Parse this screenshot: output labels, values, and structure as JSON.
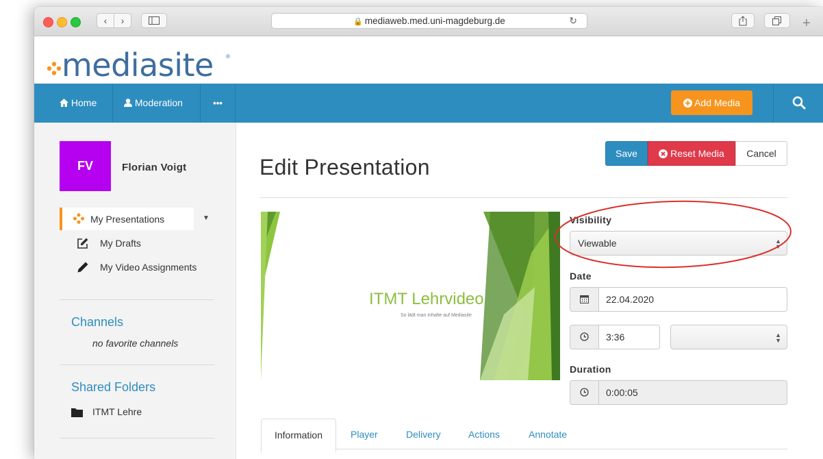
{
  "browser": {
    "url": "mediaweb.med.uni-magdeburg.de",
    "icons": [
      "back-icon",
      "forward-icon",
      "sidebar-icon",
      "lock-icon",
      "reload-icon",
      "share-icon",
      "tabs-icon",
      "new-tab-icon"
    ]
  },
  "brand": {
    "logo_text": "mediasite",
    "reg": "®",
    "colors": {
      "dots": [
        "#f7941d",
        "#c22f8b",
        "#8cc63f",
        "#2e8dbf"
      ],
      "text": "#3e6e9e"
    }
  },
  "nav": {
    "home_label": "Home",
    "moderation_label": "Moderation",
    "more_label": "•••",
    "add_media_label": "Add Media",
    "colors": {
      "bar": "#2e8dbf",
      "add_media": "#f7941d"
    }
  },
  "user": {
    "initials": "FV",
    "name": "Florian Voigt",
    "avatar_color": "#b600f0"
  },
  "sidebar": {
    "my_presentations": "My Presentations",
    "my_drafts": "My Drafts",
    "my_video_assignments": "My Video Assignments",
    "channels_heading": "Channels",
    "channels_note": "no favorite channels",
    "shared_folders_heading": "Shared Folders",
    "shared_folder_item": "ITMT Lehre"
  },
  "actions": {
    "save": "Save",
    "reset_media": "Reset Media",
    "cancel": "Cancel"
  },
  "page": {
    "title": "Edit Presentation"
  },
  "thumbnail": {
    "title": "ITMT Lehrvideo",
    "subtitle": "So lädt man Inhalte auf Mediasite"
  },
  "form": {
    "visibility_label": "Visibility",
    "visibility_value": "Viewable",
    "date_label": "Date",
    "date_value": "22.04.2020",
    "time_value": "3:36",
    "time_period_value": "",
    "duration_label": "Duration",
    "duration_value": "0:00:05"
  },
  "tabs": [
    "Information",
    "Player",
    "Delivery",
    "Actions",
    "Annotate"
  ],
  "annotation_color": "#d9302b"
}
